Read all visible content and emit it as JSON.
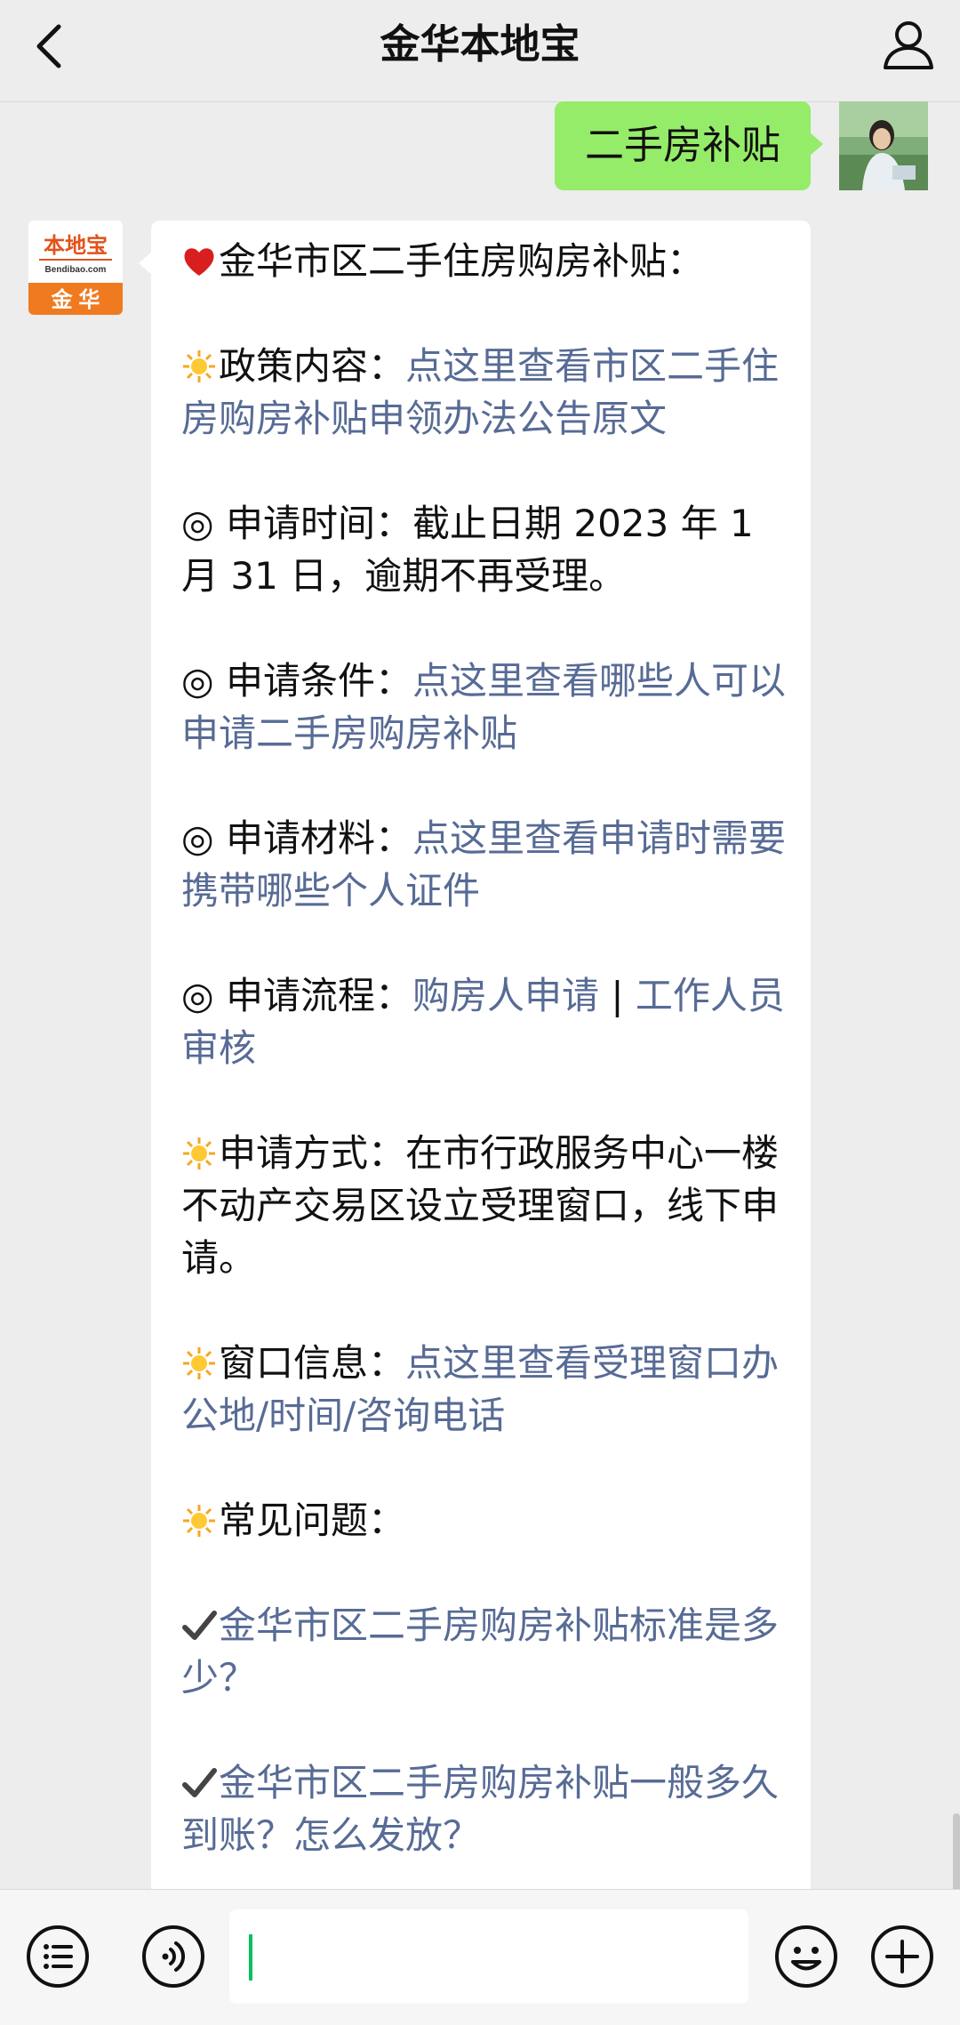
{
  "header": {
    "title": "金华本地宝",
    "back_icon": "chevron-left-icon",
    "profile_icon": "user-icon"
  },
  "outgoing": {
    "text": "二手房补贴"
  },
  "bot": {
    "avatar_top": "本地宝",
    "avatar_sub": "Bendibao.com",
    "avatar_bottom": "金 华",
    "brand_color": "#f07a1f"
  },
  "message": {
    "title": "金华市区二手住房购房补贴：",
    "policy_label": "政策内容：",
    "policy_link": "点这里查看市区二手住房购房补贴申领办法公告原文",
    "time_label": "◎ 申请时间：",
    "time_text": "截止日期 2023 年 1 月 31 日，逾期不再受理。",
    "cond_label": "◎ 申请条件：",
    "cond_link": "点这里查看哪些人可以申请二手房购房补贴",
    "material_label": "◎ 申请材料：",
    "material_link": "点这里查看申请时需要携带哪些个人证件",
    "process_label": "◎ 申请流程：",
    "process_link1": "购房人申请",
    "process_sep": " | ",
    "process_link2": "工作人员审核",
    "method_label": "申请方式：",
    "method_text": "在市行政服务中心一楼不动产交易区设立受理窗口，线下申请。",
    "window_label": "窗口信息：",
    "window_link": "点这里查看受理窗口办公地/时间/咨询电话",
    "faq_label": "常见问题：",
    "faq1": "金华市区二手房购房补贴标准是多少？",
    "faq2": "金华市区二手房购房补贴一般多久到账？怎么发放？"
  },
  "input_bar": {
    "menu_icon": "list-menu-icon",
    "voice_icon": "voice-icon",
    "emoji_icon": "smiley-icon",
    "add_icon": "plus-icon"
  }
}
